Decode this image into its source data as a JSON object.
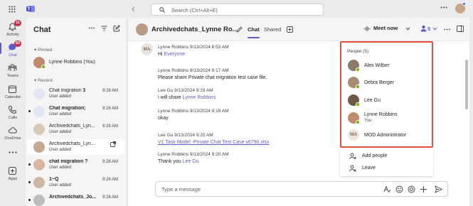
{
  "titlebar": {
    "search_placeholder": "Search (Ctrl+Alt+E)"
  },
  "rail": [
    {
      "label": "Activity",
      "badge": "11",
      "icon": "bell-icon",
      "active": false
    },
    {
      "label": "Chat",
      "badge": "60",
      "icon": "chat-icon",
      "active": true
    },
    {
      "label": "Teams",
      "badge": "",
      "icon": "teams-icon",
      "active": false
    },
    {
      "label": "Calendar",
      "badge": "",
      "icon": "calendar-icon",
      "active": false
    },
    {
      "label": "Calls",
      "badge": "",
      "icon": "phone-icon",
      "active": false
    },
    {
      "label": "OneDrive",
      "badge": "",
      "icon": "cloud-icon",
      "active": false
    },
    {
      "label": "Apps",
      "badge": "",
      "icon": "apps-icon",
      "active": false
    }
  ],
  "chatlist": {
    "title": "Chat",
    "pinned_label": "Pinned",
    "recent_label": "Recent",
    "pinned": [
      {
        "name": "Lynne Robbins (You)"
      }
    ],
    "recent": [
      {
        "name": "Chat migration $",
        "sub": "User added",
        "time": "9:28 AM",
        "bold": false,
        "unread": false
      },
      {
        "name": "Chat migration;",
        "sub": "User added",
        "time": "9:28 AM",
        "bold": true,
        "unread": true
      },
      {
        "name": "Archivedchats_Lyn...",
        "sub": "User added",
        "time": "9:28 AM",
        "bold": false,
        "unread": false
      },
      {
        "name": "Archivedchats_Lyn...",
        "sub": "User added",
        "time": "",
        "bold": false,
        "unread": false,
        "selected": true
      },
      {
        "name": "chat migration ?",
        "sub": "User added",
        "time": "9:28 AM",
        "bold": true,
        "unread": true
      },
      {
        "name": "1~Q",
        "sub": "User added",
        "time": "9:28 AM",
        "bold": true,
        "unread": true
      },
      {
        "name": "Archivedchats_Jo...",
        "sub": "",
        "time": "9:28 AM",
        "bold": true,
        "unread": true
      }
    ]
  },
  "header": {
    "title": "Archivedchats_Lynne Ro...",
    "tab_chat": "Chat",
    "tab_shared": "Shared",
    "meet_now": "Meet now",
    "people_count": "5"
  },
  "messages": [
    {
      "meta": "Lynne Robbins 9/13/2024 8:53 AM",
      "text": "Hi ",
      "mention": "Everyone"
    },
    {
      "meta": "Lynne Robbins 9/13/2024 9:17 AM",
      "text": "Please share Private chat migration test case file.",
      "mention": ""
    },
    {
      "meta": "Lee Gu 9/13/2024 9:19 AM",
      "text": "i will share ",
      "mention": "Lynne Robbins"
    },
    {
      "meta": "Lynne Robbins 9/13/2024 9:19 AM",
      "text": "okay",
      "mention": ""
    },
    {
      "meta": "Lee Gu 9/13/2024 9:20 AM",
      "text": "",
      "link": "V1 Task Model -Private Chat Test Case v6790.xlsx"
    },
    {
      "meta": "Lynne Robbins 9/13/2024 9:20 AM",
      "text": "Thank you ",
      "mention": "Lee Gu"
    }
  ],
  "avatar_initials": "MA",
  "compose": {
    "placeholder": "Type a message"
  },
  "people": {
    "title": "People (5)",
    "members": [
      {
        "name": "Alex Wilber",
        "sub": ""
      },
      {
        "name": "Debra Berger",
        "sub": ""
      },
      {
        "name": "Lee Gu",
        "sub": ""
      },
      {
        "name": "Lynne Robbins",
        "sub": "You"
      },
      {
        "name": "MOD Administrator",
        "sub": "",
        "initials": "MA"
      }
    ],
    "actions": [
      "Add people",
      "Leave"
    ]
  },
  "colors": {
    "accent": "#5b5fc7",
    "highlight_border": "#e74c3c",
    "badge": "#c4314b",
    "presence": "#6bb700"
  }
}
